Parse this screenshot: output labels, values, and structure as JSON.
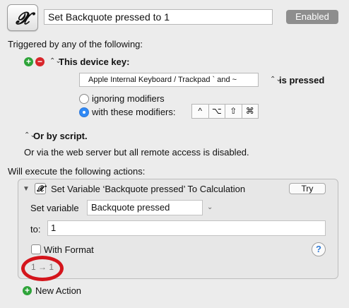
{
  "macro": {
    "name": "Set Backquote pressed to 1",
    "enabled_label": "Enabled"
  },
  "trigger": {
    "heading": "Triggered by any of the following:",
    "device_key_label": "This device key:",
    "key_value": "Apple Internal Keyboard / Trackpad ` and ~",
    "condition": "is pressed",
    "ignoring_modifiers": "ignoring modifiers",
    "with_these_modifiers": "with these modifiers:",
    "modifier_keys": [
      "^",
      "⌥",
      "⇧",
      "⌘"
    ],
    "or_by_script": "Or by script.",
    "web_server_note": "Or via the web server but all remote access is disabled."
  },
  "actions": {
    "heading": "Will execute the following actions:",
    "action_title": "Set Variable ‘Backquote pressed’ To Calculation",
    "try_label": "Try",
    "set_variable_label": "Set variable",
    "variable_name": "Backquote pressed",
    "to_label": "to:",
    "to_value": "1",
    "with_format_label": "With Format",
    "help_label": "?",
    "result_preview": "1 → 1",
    "new_action_label": "New Action"
  },
  "colors": {
    "add": "#2fa43a",
    "remove": "#d8262b",
    "radio_selected": "#2f89f5",
    "highlight_ellipse": "#d4151c",
    "enabled_button": "#8e8e8e"
  }
}
